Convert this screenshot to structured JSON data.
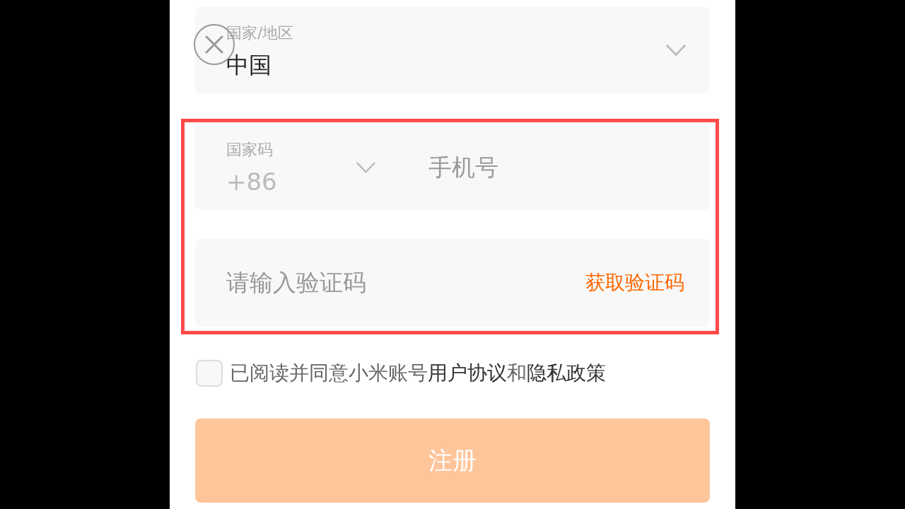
{
  "region_field": {
    "label": "国家/地区",
    "value": "中国"
  },
  "phone_field": {
    "code_label": "国家码",
    "code_value": "+86",
    "placeholder": "手机号"
  },
  "code_field": {
    "placeholder": "请输入验证码",
    "action": "获取验证码"
  },
  "agreement": {
    "checked": false,
    "parts": [
      {
        "kind": "plain",
        "text": "已阅读并同意小米账号"
      },
      {
        "kind": "link",
        "text": "用户协议"
      },
      {
        "kind": "plain",
        "text": "和"
      },
      {
        "kind": "link",
        "text": "隐私政策"
      }
    ]
  },
  "submit_button": {
    "label": "注册",
    "disabled": true
  }
}
